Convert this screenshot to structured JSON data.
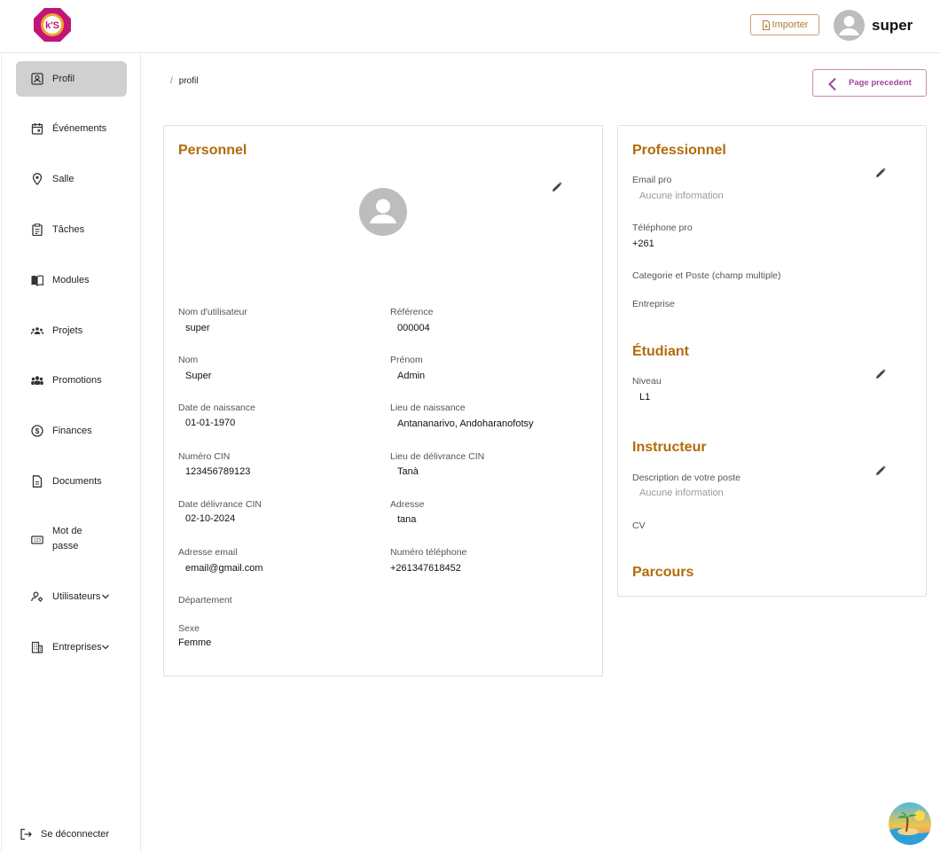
{
  "header": {
    "logo_text": "k'S",
    "import_label": "Importer",
    "user_name": "super"
  },
  "sidebar": {
    "items": [
      {
        "label": "Profil",
        "icon": "profile-icon",
        "active": true
      },
      {
        "label": "Événements",
        "icon": "calendar-icon"
      },
      {
        "label": "Salle",
        "icon": "location-pin-icon"
      },
      {
        "label": "Tâches",
        "icon": "clipboard-icon"
      },
      {
        "label": "Modules",
        "icon": "book-icon"
      },
      {
        "label": "Projets",
        "icon": "group-icon"
      },
      {
        "label": "Promotions",
        "icon": "groups-icon"
      },
      {
        "label": "Finances",
        "icon": "dollar-icon"
      },
      {
        "label": "Documents",
        "icon": "document-icon"
      },
      {
        "label": "Mot de\npasse",
        "icon": "password-icon"
      },
      {
        "label": "Utilisateurs",
        "icon": "user-settings-icon",
        "dropdown": true
      },
      {
        "label": "Entreprises",
        "icon": "building-icon",
        "dropdown": true
      }
    ],
    "logout_label": "Se déconnecter"
  },
  "breadcrumb": {
    "separator": "/",
    "current": "profil"
  },
  "back_button_label": "Page precedent",
  "personnel": {
    "title": "Personnel",
    "fields": {
      "username": {
        "label": "Nom d'utilisateur",
        "value": "super"
      },
      "reference": {
        "label": "Référence",
        "value": "000004"
      },
      "nom": {
        "label": "Nom",
        "value": "Super"
      },
      "prenom": {
        "label": "Prénom",
        "value": "Admin"
      },
      "date_naissance": {
        "label": "Date de naissance",
        "value": "01-01-1970"
      },
      "lieu_naissance": {
        "label": "Lieu de naissance",
        "value": "Antananarivo, Andoharanofotsy"
      },
      "cin": {
        "label": "Numéro CIN",
        "value": "123456789123"
      },
      "lieu_cin": {
        "label": "Lieu de délivrance CIN",
        "value": "Tanà"
      },
      "date_cin": {
        "label": "Date délivrance CIN",
        "value": "02-10-2024"
      },
      "adresse": {
        "label": "Adresse",
        "value": "tana"
      },
      "email": {
        "label": "Adresse email",
        "value": "email@gmail.com"
      },
      "telephone": {
        "label": "Numéro téléphone",
        "value": "+261347618452"
      },
      "departement": {
        "label": "Département",
        "value": ""
      },
      "sexe": {
        "label": "Sexe",
        "value": "Femme"
      }
    }
  },
  "professionnel": {
    "title": "Professionnel",
    "email_pro": {
      "label": "Email pro",
      "value": "Aucune information"
    },
    "tel_pro": {
      "label": "Téléphone pro",
      "value": "+261"
    },
    "categorie": {
      "label": "Categorie et Poste (champ multiple)"
    },
    "entreprise": {
      "label": "Entreprise"
    }
  },
  "etudiant": {
    "title": "Étudiant",
    "niveau": {
      "label": "Niveau",
      "value": "L1"
    }
  },
  "instructeur": {
    "title": "Instructeur",
    "description": {
      "label": "Description de votre poste",
      "value": "Aucune information"
    },
    "cv": {
      "label": "CV"
    }
  },
  "parcours": {
    "title": "Parcours"
  },
  "colors": {
    "accent": "#b26b0a",
    "back_button": "#a0479a",
    "import_border": "#c8a070",
    "active_nav": "#d0d0d0"
  }
}
